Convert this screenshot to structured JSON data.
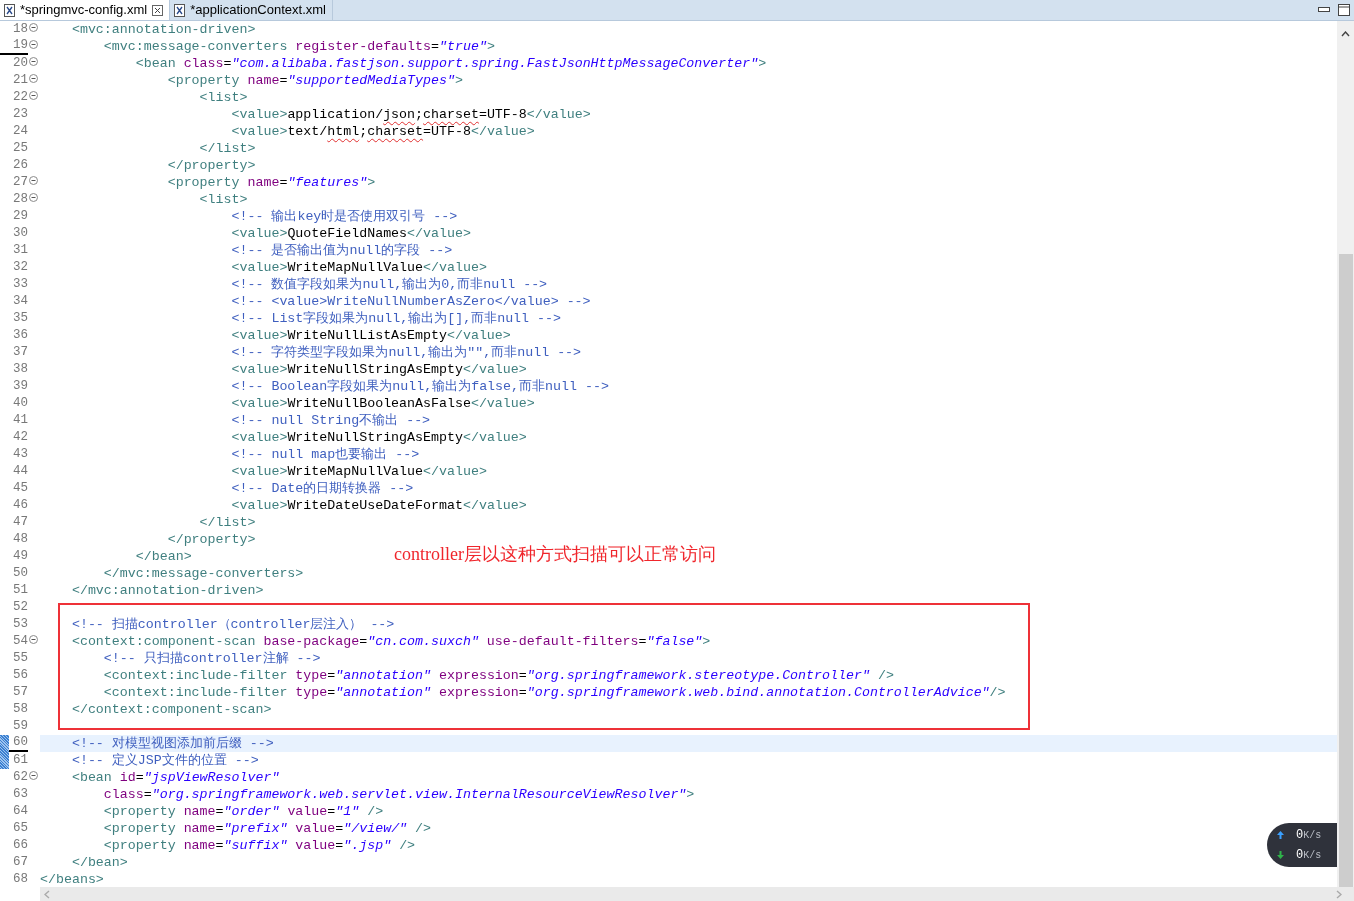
{
  "tabs": [
    {
      "label": "*springmvc-config.xml",
      "selected": true,
      "closable": true
    },
    {
      "label": "*applicationContext.xml",
      "selected": false,
      "closable": false
    }
  ],
  "lines": [
    {
      "number": "18",
      "foldable": true,
      "tokens": [
        {
          "kind": "tag",
          "text": "    <mvc:annotation-driven>"
        }
      ]
    },
    {
      "number": "19",
      "foldable": true,
      "underlined": true,
      "tokens": [
        {
          "kind": "tag",
          "text": "        <mvc:message-converters"
        },
        {
          "kind": "attr",
          "text": " register-defaults"
        },
        {
          "kind": "plain",
          "text": "="
        },
        {
          "kind": "value",
          "text": "\"true\""
        },
        {
          "kind": "tag",
          "text": ">"
        }
      ]
    },
    {
      "number": "20",
      "foldable": true,
      "tokens": [
        {
          "kind": "tag",
          "text": "            <bean"
        },
        {
          "kind": "attr",
          "text": " class"
        },
        {
          "kind": "plain",
          "text": "="
        },
        {
          "kind": "value",
          "text": "\"com.alibaba.fastjson.support.spring.FastJsonHttpMessageConverter\""
        },
        {
          "kind": "tag",
          "text": ">"
        }
      ]
    },
    {
      "number": "21",
      "foldable": true,
      "tokens": [
        {
          "kind": "tag",
          "text": "                <property"
        },
        {
          "kind": "attr",
          "text": " name"
        },
        {
          "kind": "plain",
          "text": "="
        },
        {
          "kind": "value",
          "text": "\"supportedMediaTypes\""
        },
        {
          "kind": "tag",
          "text": ">"
        }
      ]
    },
    {
      "number": "22",
      "foldable": true,
      "tokens": [
        {
          "kind": "tag",
          "text": "                    <list>"
        }
      ]
    },
    {
      "number": "23",
      "tokens": [
        {
          "kind": "tag",
          "text": "                        <value>"
        },
        {
          "kind": "plain",
          "text": "application/"
        },
        {
          "kind": "plain",
          "text": "json",
          "misspelled": true
        },
        {
          "kind": "plain",
          "text": ";"
        },
        {
          "kind": "plain",
          "text": "charset",
          "misspelled": true
        },
        {
          "kind": "plain",
          "text": "=UTF-8"
        },
        {
          "kind": "tag",
          "text": "</value>"
        }
      ]
    },
    {
      "number": "24",
      "tokens": [
        {
          "kind": "tag",
          "text": "                        <value>"
        },
        {
          "kind": "plain",
          "text": "text/"
        },
        {
          "kind": "plain",
          "text": "html",
          "misspelled": true
        },
        {
          "kind": "plain",
          "text": ";"
        },
        {
          "kind": "plain",
          "text": "charset",
          "misspelled": true
        },
        {
          "kind": "plain",
          "text": "=UTF-8"
        },
        {
          "kind": "tag",
          "text": "</value>"
        }
      ]
    },
    {
      "number": "25",
      "tokens": [
        {
          "kind": "tag",
          "text": "                    </list>"
        }
      ]
    },
    {
      "number": "26",
      "tokens": [
        {
          "kind": "tag",
          "text": "                </property>"
        }
      ]
    },
    {
      "number": "27",
      "foldable": true,
      "tokens": [
        {
          "kind": "tag",
          "text": "                <property"
        },
        {
          "kind": "attr",
          "text": " name"
        },
        {
          "kind": "plain",
          "text": "="
        },
        {
          "kind": "value",
          "text": "\"features\""
        },
        {
          "kind": "tag",
          "text": ">"
        }
      ]
    },
    {
      "number": "28",
      "foldable": true,
      "tokens": [
        {
          "kind": "tag",
          "text": "                    <list>"
        }
      ]
    },
    {
      "number": "29",
      "tokens": [
        {
          "kind": "comment",
          "text": "                        <!-- 输出key时是否使用双引号 -->"
        }
      ]
    },
    {
      "number": "30",
      "tokens": [
        {
          "kind": "tag",
          "text": "                        <value>"
        },
        {
          "kind": "plain",
          "text": "QuoteFieldNames"
        },
        {
          "kind": "tag",
          "text": "</value>"
        }
      ]
    },
    {
      "number": "31",
      "tokens": [
        {
          "kind": "comment",
          "text": "                        <!-- 是否输出值为null的字段 -->"
        }
      ]
    },
    {
      "number": "32",
      "tokens": [
        {
          "kind": "tag",
          "text": "                        <value>"
        },
        {
          "kind": "plain",
          "text": "WriteMapNullValue"
        },
        {
          "kind": "tag",
          "text": "</value>"
        }
      ]
    },
    {
      "number": "33",
      "tokens": [
        {
          "kind": "comment",
          "text": "                        <!-- 数值字段如果为null,输出为0,而非null -->"
        }
      ]
    },
    {
      "number": "34",
      "tokens": [
        {
          "kind": "comment",
          "text": "                        <!-- <value>WriteNullNumberAsZero</value> -->"
        }
      ]
    },
    {
      "number": "35",
      "tokens": [
        {
          "kind": "comment",
          "text": "                        <!-- List字段如果为null,输出为[],而非null -->"
        }
      ]
    },
    {
      "number": "36",
      "tokens": [
        {
          "kind": "tag",
          "text": "                        <value>"
        },
        {
          "kind": "plain",
          "text": "WriteNullListAsEmpty"
        },
        {
          "kind": "tag",
          "text": "</value>"
        }
      ]
    },
    {
      "number": "37",
      "tokens": [
        {
          "kind": "comment",
          "text": "                        <!-- 字符类型字段如果为null,输出为\"\",而非null -->"
        }
      ]
    },
    {
      "number": "38",
      "tokens": [
        {
          "kind": "tag",
          "text": "                        <value>"
        },
        {
          "kind": "plain",
          "text": "WriteNullStringAsEmpty"
        },
        {
          "kind": "tag",
          "text": "</value>"
        }
      ]
    },
    {
      "number": "39",
      "tokens": [
        {
          "kind": "comment",
          "text": "                        <!-- Boolean字段如果为null,输出为false,而非null -->"
        }
      ]
    },
    {
      "number": "40",
      "tokens": [
        {
          "kind": "tag",
          "text": "                        <value>"
        },
        {
          "kind": "plain",
          "text": "WriteNullBooleanAsFalse"
        },
        {
          "kind": "tag",
          "text": "</value>"
        }
      ]
    },
    {
      "number": "41",
      "tokens": [
        {
          "kind": "comment",
          "text": "                        <!-- null String不输出 -->"
        }
      ]
    },
    {
      "number": "42",
      "tokens": [
        {
          "kind": "tag",
          "text": "                        <value>"
        },
        {
          "kind": "plain",
          "text": "WriteNullStringAsEmpty"
        },
        {
          "kind": "tag",
          "text": "</value>"
        }
      ]
    },
    {
      "number": "43",
      "tokens": [
        {
          "kind": "comment",
          "text": "                        <!-- null map也要输出 -->"
        }
      ]
    },
    {
      "number": "44",
      "tokens": [
        {
          "kind": "tag",
          "text": "                        <value>"
        },
        {
          "kind": "plain",
          "text": "WriteMapNullValue"
        },
        {
          "kind": "tag",
          "text": "</value>"
        }
      ]
    },
    {
      "number": "45",
      "tokens": [
        {
          "kind": "comment",
          "text": "                        <!-- Date的日期转换器 -->"
        }
      ]
    },
    {
      "number": "46",
      "tokens": [
        {
          "kind": "tag",
          "text": "                        <value>"
        },
        {
          "kind": "plain",
          "text": "WriteDateUseDateFormat"
        },
        {
          "kind": "tag",
          "text": "</value>"
        }
      ]
    },
    {
      "number": "47",
      "tokens": [
        {
          "kind": "tag",
          "text": "                    </list>"
        }
      ]
    },
    {
      "number": "48",
      "tokens": [
        {
          "kind": "tag",
          "text": "                </property>"
        }
      ]
    },
    {
      "number": "49",
      "note": "controller层以这种方式扫描可以正常访问",
      "tokens": [
        {
          "kind": "tag",
          "text": "            </bean>"
        }
      ]
    },
    {
      "number": "50",
      "tokens": [
        {
          "kind": "tag",
          "text": "        </mvc:message-converters>"
        }
      ]
    },
    {
      "number": "51",
      "tokens": [
        {
          "kind": "tag",
          "text": "    </mvc:annotation-driven>"
        }
      ]
    },
    {
      "number": "52"
    },
    {
      "number": "53",
      "boxed": true,
      "tokens": [
        {
          "kind": "comment",
          "text": "    <!-- 扫描controller（controller层注入） -->"
        }
      ]
    },
    {
      "number": "54",
      "boxed": true,
      "foldable": true,
      "tokens": [
        {
          "kind": "tag",
          "text": "    <context:component-scan"
        },
        {
          "kind": "attr",
          "text": " base-package"
        },
        {
          "kind": "plain",
          "text": "="
        },
        {
          "kind": "value",
          "text": "\"cn.com.suxch\""
        },
        {
          "kind": "attr",
          "text": " use-default-filters"
        },
        {
          "kind": "plain",
          "text": "="
        },
        {
          "kind": "value",
          "text": "\"false\""
        },
        {
          "kind": "tag",
          "text": ">"
        }
      ]
    },
    {
      "number": "55",
      "boxed": true,
      "tokens": [
        {
          "kind": "comment",
          "text": "        <!-- 只扫描controller注解 -->"
        }
      ]
    },
    {
      "number": "56",
      "boxed": true,
      "tokens": [
        {
          "kind": "tag",
          "text": "        <context:include-filter"
        },
        {
          "kind": "attr",
          "text": " type"
        },
        {
          "kind": "plain",
          "text": "="
        },
        {
          "kind": "value",
          "text": "\"annotation\""
        },
        {
          "kind": "attr",
          "text": " expression"
        },
        {
          "kind": "plain",
          "text": "="
        },
        {
          "kind": "value",
          "text": "\"org.springframework.stereotype.Controller\""
        },
        {
          "kind": "tag",
          "text": " />"
        }
      ]
    },
    {
      "number": "57",
      "boxed": true,
      "tokens": [
        {
          "kind": "tag",
          "text": "        <context:include-filter"
        },
        {
          "kind": "attr",
          "text": " type"
        },
        {
          "kind": "plain",
          "text": "="
        },
        {
          "kind": "value",
          "text": "\"annotation\""
        },
        {
          "kind": "attr",
          "text": " expression"
        },
        {
          "kind": "plain",
          "text": "="
        },
        {
          "kind": "value",
          "text": "\"org.springframework.web.bind.annotation.ControllerAdvice\""
        },
        {
          "kind": "tag",
          "text": "/>"
        }
      ]
    },
    {
      "number": "58",
      "boxed": true,
      "tokens": [
        {
          "kind": "tag",
          "text": "    </context:component-scan>"
        }
      ]
    },
    {
      "number": "59"
    },
    {
      "number": "60",
      "current": true,
      "changed": true,
      "underlined": true,
      "tokens": [
        {
          "kind": "comment",
          "text": "    <!-- 对模型视图添加前后缀 -->"
        }
      ]
    },
    {
      "number": "61",
      "changed": true,
      "tokens": [
        {
          "kind": "comment",
          "text": "    <!-- 定义JSP文件的位置 -->"
        }
      ]
    },
    {
      "number": "62",
      "foldable": true,
      "tokens": [
        {
          "kind": "tag",
          "text": "    <bean"
        },
        {
          "kind": "attr",
          "text": " id"
        },
        {
          "kind": "plain",
          "text": "="
        },
        {
          "kind": "value",
          "text": "\"jspViewResolver\""
        }
      ]
    },
    {
      "number": "63",
      "tokens": [
        {
          "kind": "attr",
          "text": "        class"
        },
        {
          "kind": "plain",
          "text": "="
        },
        {
          "kind": "value",
          "text": "\"org.springframework.web.servlet.view.InternalResourceViewResolver\""
        },
        {
          "kind": "tag",
          "text": ">"
        }
      ]
    },
    {
      "number": "64",
      "tokens": [
        {
          "kind": "tag",
          "text": "        <property"
        },
        {
          "kind": "attr",
          "text": " name"
        },
        {
          "kind": "plain",
          "text": "="
        },
        {
          "kind": "value",
          "text": "\"order\""
        },
        {
          "kind": "attr",
          "text": " value"
        },
        {
          "kind": "plain",
          "text": "="
        },
        {
          "kind": "value",
          "text": "\"1\""
        },
        {
          "kind": "tag",
          "text": " />"
        }
      ]
    },
    {
      "number": "65",
      "tokens": [
        {
          "kind": "tag",
          "text": "        <property"
        },
        {
          "kind": "attr",
          "text": " name"
        },
        {
          "kind": "plain",
          "text": "="
        },
        {
          "kind": "value",
          "text": "\"prefix\""
        },
        {
          "kind": "attr",
          "text": " value"
        },
        {
          "kind": "plain",
          "text": "="
        },
        {
          "kind": "value",
          "text": "\"/view/\""
        },
        {
          "kind": "tag",
          "text": " />"
        }
      ]
    },
    {
      "number": "66",
      "tokens": [
        {
          "kind": "tag",
          "text": "        <property"
        },
        {
          "kind": "attr",
          "text": " name"
        },
        {
          "kind": "plain",
          "text": "="
        },
        {
          "kind": "value",
          "text": "\"suffix\""
        },
        {
          "kind": "attr",
          "text": " value"
        },
        {
          "kind": "plain",
          "text": "="
        },
        {
          "kind": "value",
          "text": "\".jsp\""
        },
        {
          "kind": "tag",
          "text": " />"
        }
      ]
    },
    {
      "number": "67",
      "tokens": [
        {
          "kind": "tag",
          "text": "    </bean>"
        }
      ]
    },
    {
      "number": "68",
      "tokens": [
        {
          "kind": "tag",
          "text": "</beans>"
        }
      ]
    }
  ],
  "net_speed": [
    {
      "kind": "up",
      "value": "0",
      "unit": "K/s"
    },
    {
      "kind": "down",
      "value": "0",
      "unit": "K/s"
    }
  ]
}
